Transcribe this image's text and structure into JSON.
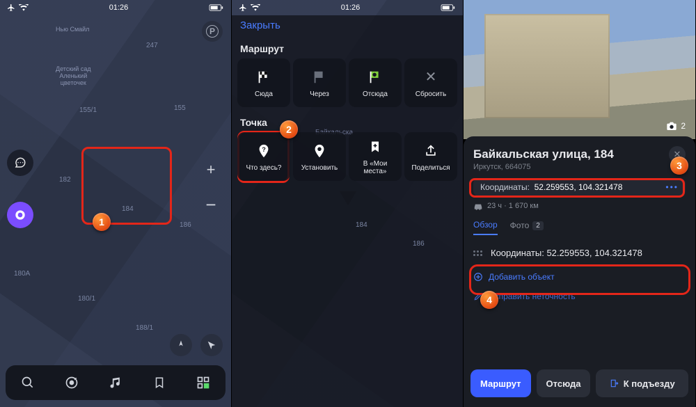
{
  "status": {
    "time": "01:26"
  },
  "panel1": {
    "poi1": "Нью Смайл",
    "poi2": "Детский сад\nАленький\nцветочек",
    "hn": {
      "a": "247",
      "b": "155/1",
      "c": "182",
      "d": "184",
      "e": "186",
      "f": "180A",
      "g": "180/1",
      "h": "188/1",
      "i": "155"
    }
  },
  "panel2": {
    "close": "Закрыть",
    "route_title": "Маршрут",
    "to": "Сюда",
    "via": "Через",
    "from": "Отсюда",
    "reset": "Сбросить",
    "point_title": "Точка",
    "what": "Что здесь?",
    "set": "Установить",
    "fav": "В «Мои\nместа»",
    "share": "Поделиться",
    "hn": {
      "a": "184",
      "b": "186"
    },
    "poi_frag": "Байкальска"
  },
  "panel3": {
    "title": "Байкальская улица, 184",
    "subtitle": "Иркутск, 664075",
    "coord_label": "Координаты:",
    "coord_value": "52.259553, 104.321478",
    "travel": "23 ч · 1 670 км",
    "tab_overview": "Обзор",
    "tab_photo": "Фото",
    "tab_photo_count": "2",
    "big_coord": "Координаты: 52.259553, 104.321478",
    "add_object": "Добавить объект",
    "fix": "Исправить неточность",
    "btn_route": "Маршрут",
    "btn_from": "Отсюда",
    "btn_entrance": "К подъезду",
    "photo_count": "2"
  },
  "callouts": {
    "c1": "1",
    "c2": "2",
    "c3": "3",
    "c4": "4"
  }
}
